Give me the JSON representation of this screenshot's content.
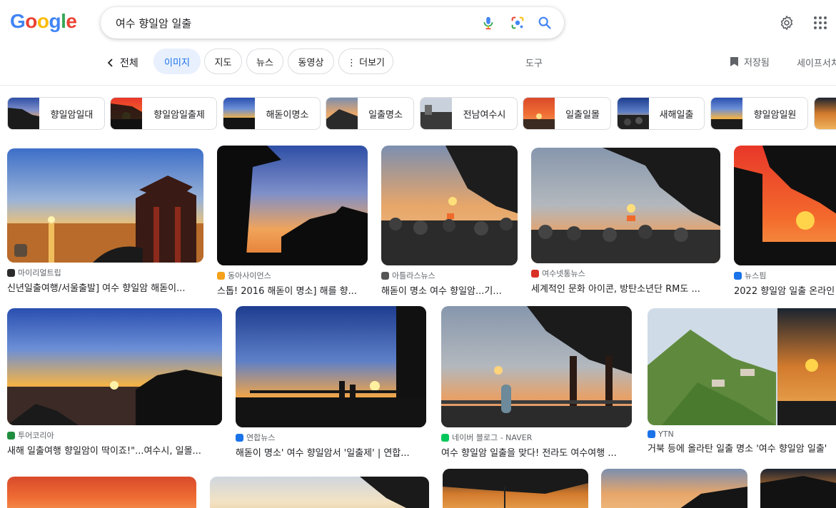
{
  "header": {
    "logo": {
      "letters": [
        "G",
        "o",
        "o",
        "g",
        "l",
        "e"
      ],
      "colors": [
        "#4285F4",
        "#EA4335",
        "#FBBC05",
        "#4285F4",
        "#34A853",
        "#EA4335"
      ]
    },
    "search_query": "여수 향일암 일출"
  },
  "tabs": {
    "back_all": "전체",
    "items": [
      {
        "label": "이미지",
        "active": true
      },
      {
        "label": "지도",
        "active": false
      },
      {
        "label": "뉴스",
        "active": false
      },
      {
        "label": "동영상",
        "active": false
      },
      {
        "label": "⋮ 더보기",
        "active": false
      }
    ],
    "tools": "도구",
    "saved": "저장됨",
    "safesearch": "세이프서치"
  },
  "chips": [
    {
      "label": "향일암일대"
    },
    {
      "label": "향일암일출제"
    },
    {
      "label": "해돋이명소"
    },
    {
      "label": "일출명소"
    },
    {
      "label": "전남여수시"
    },
    {
      "label": "일출일몰"
    },
    {
      "label": "새해일출"
    },
    {
      "label": "향일암일원"
    }
  ],
  "results": [
    {
      "source": "마이리얼트립",
      "title": "신년일출여행/서울출발] 여수 향일암 해돋이...",
      "favicon_color": "#2b2b2b"
    },
    {
      "source": "동아사이언스",
      "title": "스톱! 2016 해돋이 명소] 해를 향...",
      "favicon_color": "#f4a21b"
    },
    {
      "source": "아틀라스뉴스",
      "title": "해돋이 명소 여수 향일암...기...",
      "favicon_color": "#555555"
    },
    {
      "source": "여수넷통뉴스",
      "title": "세계적인 문화 아이콘, 방탄소년단 RM도 ...",
      "favicon_color": "#d93025"
    },
    {
      "source": "뉴스핌",
      "title": "2022 향일암 일출 온라인",
      "favicon_color": "#1a73e8"
    },
    {
      "source": "투어코리아",
      "title": "새해 일출여행 향일암이 딱이죠!\"...여수시, 일몰...",
      "favicon_color": "#1e8e3e"
    },
    {
      "source": "연합뉴스",
      "title": "해돋이 명소' 여수 향일암서 '일출제' | 연합...",
      "favicon_color": "#1a73e8"
    },
    {
      "source": "네이버 블로그 - NAVER",
      "title": "여수 향일암 일출을 맞다! 전라도 여수여행 ...",
      "favicon_color": "#03c75a"
    },
    {
      "source": "YTN",
      "title": "거북 등에 올라탄 일출 명소 '여수 향일암 일출'",
      "favicon_color": "#1a73e8"
    }
  ]
}
